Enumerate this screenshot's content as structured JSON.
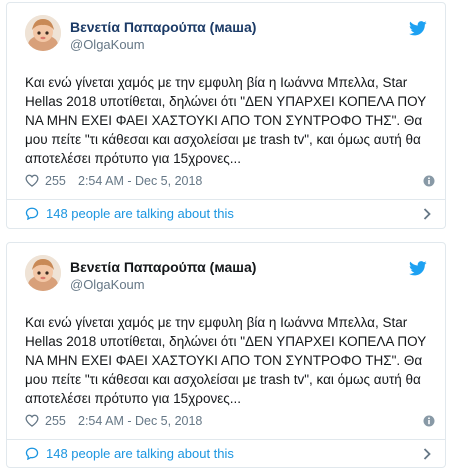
{
  "tweets": [
    {
      "display_name": "Βενετία Παπαρούπα (маша)",
      "handle": "@OlgaKoum",
      "text": "Και ενώ γίνεται χαμός με την εμφυλη βία η Ιωάννα Μπελλα, Star Hellas 2018 υποτίθεται, δηλώνει ότι \"ΔΕΝ ΥΠΑΡΧΕΙ ΚΟΠΕΛΑ ΠΟΥ ΝΑ ΜΗΝ ΕΧΕΙ ΦΑΕΙ ΧΑΣΤΟΥΚΙ ΑΠΟ ΤΟΝ ΣΥΝΤΡΟΦΟ ΤΗΣ\". Θα μου πείτε \"τι κάθεσαι και ασχολείσαι με trash tv\", και όμως αυτή θα αποτελέσει πρότυπο για 15χρονες...",
      "likes": "255",
      "timestamp": "2:54 AM - Dec 5, 2018",
      "talking": "148 people are talking about this"
    },
    {
      "display_name": "Βενετία Παπαρούπα (маша)",
      "handle": "@OlgaKoum",
      "text": "Και ενώ γίνεται χαμός με την εμφυλη βία η Ιωάννα Μπελλα, Star Hellas 2018 υποτίθεται, δηλώνει ότι \"ΔΕΝ ΥΠΑΡΧΕΙ ΚΟΠΕΛΑ ΠΟΥ ΝΑ ΜΗΝ ΕΧΕΙ ΦΑΕΙ ΧΑΣΤΟΥΚΙ ΑΠΟ ΤΟΝ ΣΥΝΤΡΟΦΟ ΤΗΣ\". Θα μου πείτε \"τι κάθεσαι και ασχολείσαι με trash tv\", και όμως αυτή θα αποτελέσει πρότυπο για 15χρονες...",
      "likes": "255",
      "timestamp": "2:54 AM - Dec 5, 2018",
      "talking": "148 people are talking about this"
    }
  ],
  "colors": {
    "link_blue": "#1b95e0",
    "twitter_blue": "#1da1f2",
    "muted_gray": "#657786",
    "border": "#e1e8ed"
  },
  "icons": {
    "bird": "twitter-bird-icon",
    "heart": "heart-icon",
    "info": "info-icon",
    "talk": "speech-bubble-icon",
    "chevron": "chevron-right-icon"
  }
}
